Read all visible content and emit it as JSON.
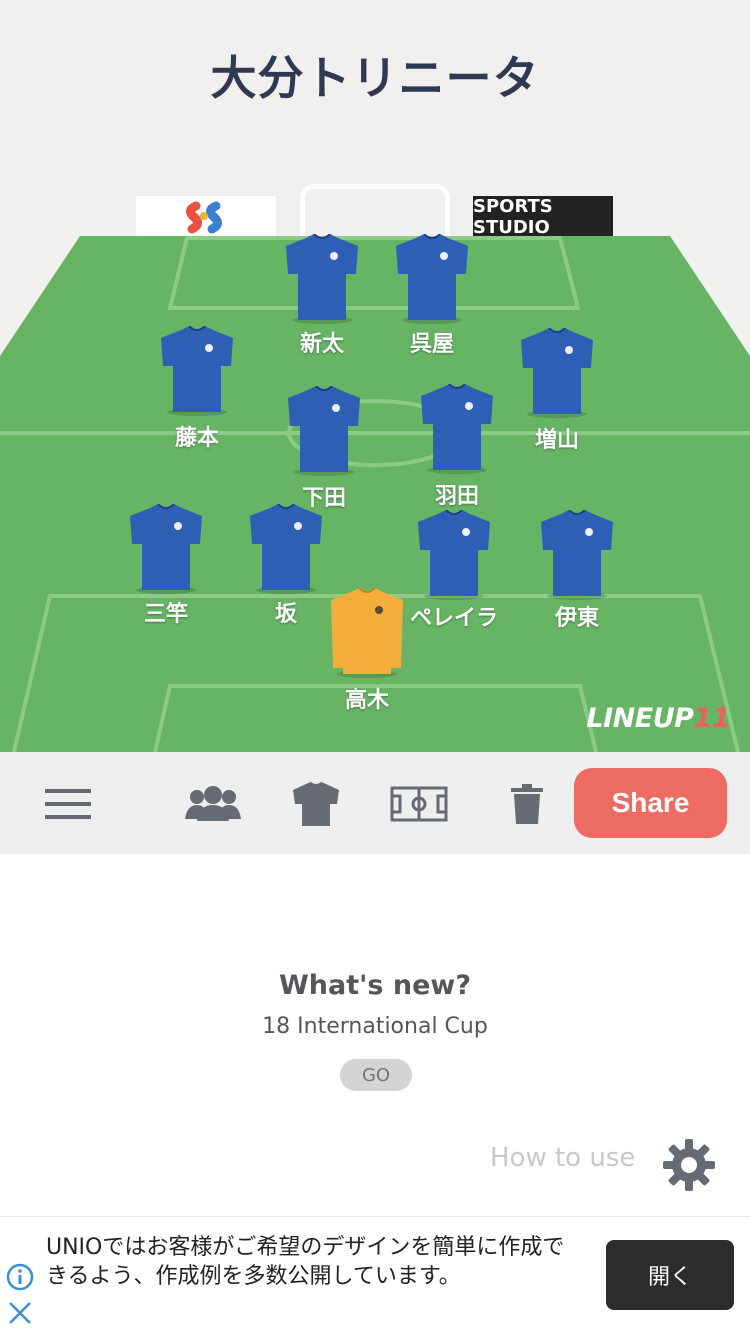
{
  "team": {
    "name": "大分トリニータ"
  },
  "sponsors": {
    "right_label": "SPORTS STUDIO"
  },
  "colors": {
    "pitch": "#67b465",
    "kit": "#2f5fb5",
    "keeper_kit": "#f3ad3d",
    "share": "#ec6b62"
  },
  "players": [
    {
      "name": "新太",
      "role": "outfield"
    },
    {
      "name": "呉屋",
      "role": "outfield"
    },
    {
      "name": "藤本",
      "role": "outfield"
    },
    {
      "name": "増山",
      "role": "outfield"
    },
    {
      "name": "下田",
      "role": "outfield"
    },
    {
      "name": "羽田",
      "role": "outfield"
    },
    {
      "name": "三竿",
      "role": "outfield"
    },
    {
      "name": "坂",
      "role": "outfield"
    },
    {
      "name": "ペレイラ",
      "role": "outfield"
    },
    {
      "name": "伊東",
      "role": "outfield"
    },
    {
      "name": "高木",
      "role": "goalkeeper"
    }
  ],
  "brand": {
    "lineup_text": "LINEUP",
    "lineup_num": "11"
  },
  "toolbar": {
    "icons": [
      "menu-icon",
      "players-icon",
      "kit-icon",
      "pitch-icon",
      "trash-icon"
    ],
    "share_label": "Share"
  },
  "news": {
    "title": "What's new?",
    "subtitle": "18 International Cup",
    "go_label": "GO"
  },
  "howto": {
    "label": "How to use"
  },
  "ad": {
    "text": "UNIOではお客様がご希望のデザインを簡単に作成できるよう、作成例を多数公開しています。",
    "button_label": "開く"
  }
}
